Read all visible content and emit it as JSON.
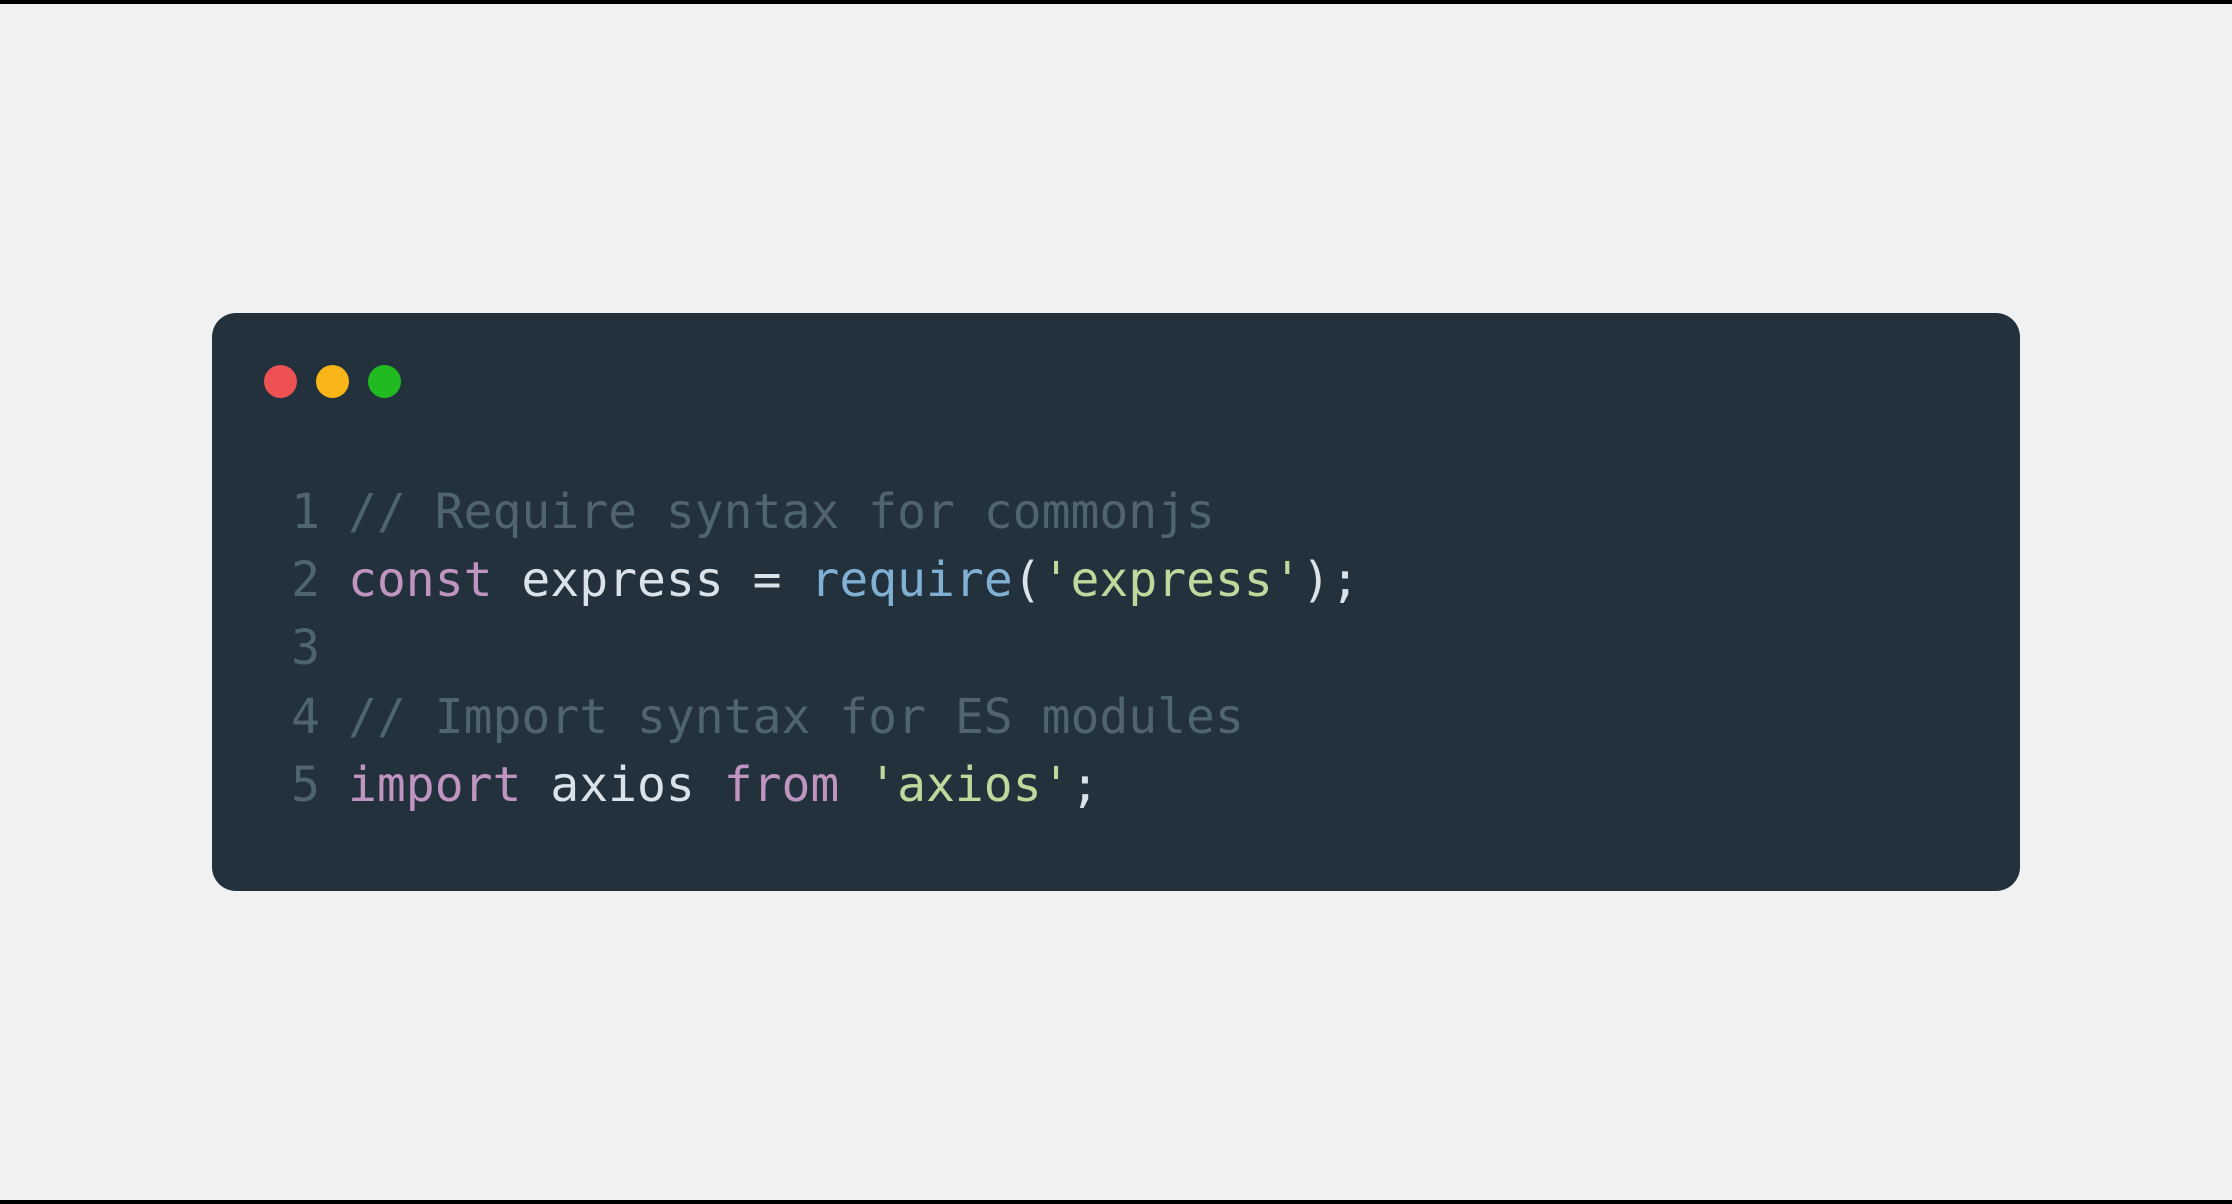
{
  "colors": {
    "red": "#ee5151",
    "yellow": "#fab618",
    "green": "#21bb21",
    "bg": "#22313c"
  },
  "lineNumbers": {
    "l1": "1",
    "l2": "2",
    "l3": "3",
    "l4": "4",
    "l5": "5"
  },
  "code": {
    "line1": {
      "comment": "// Require syntax for commonjs"
    },
    "line2": {
      "keyword": "const",
      "space1": " ",
      "identifier": "express",
      "space2": " ",
      "operator": "=",
      "space3": " ",
      "function": "require",
      "parenOpen": "(",
      "string": "'express'",
      "parenClose": ")",
      "semicolon": ";"
    },
    "line3": {
      "empty": ""
    },
    "line4": {
      "comment": "// Import syntax for ES modules"
    },
    "line5": {
      "keyword1": "import",
      "space1": " ",
      "identifier": "axios",
      "space2": " ",
      "keyword2": "from",
      "space3": " ",
      "string": "'axios'",
      "semicolon": ";"
    }
  }
}
